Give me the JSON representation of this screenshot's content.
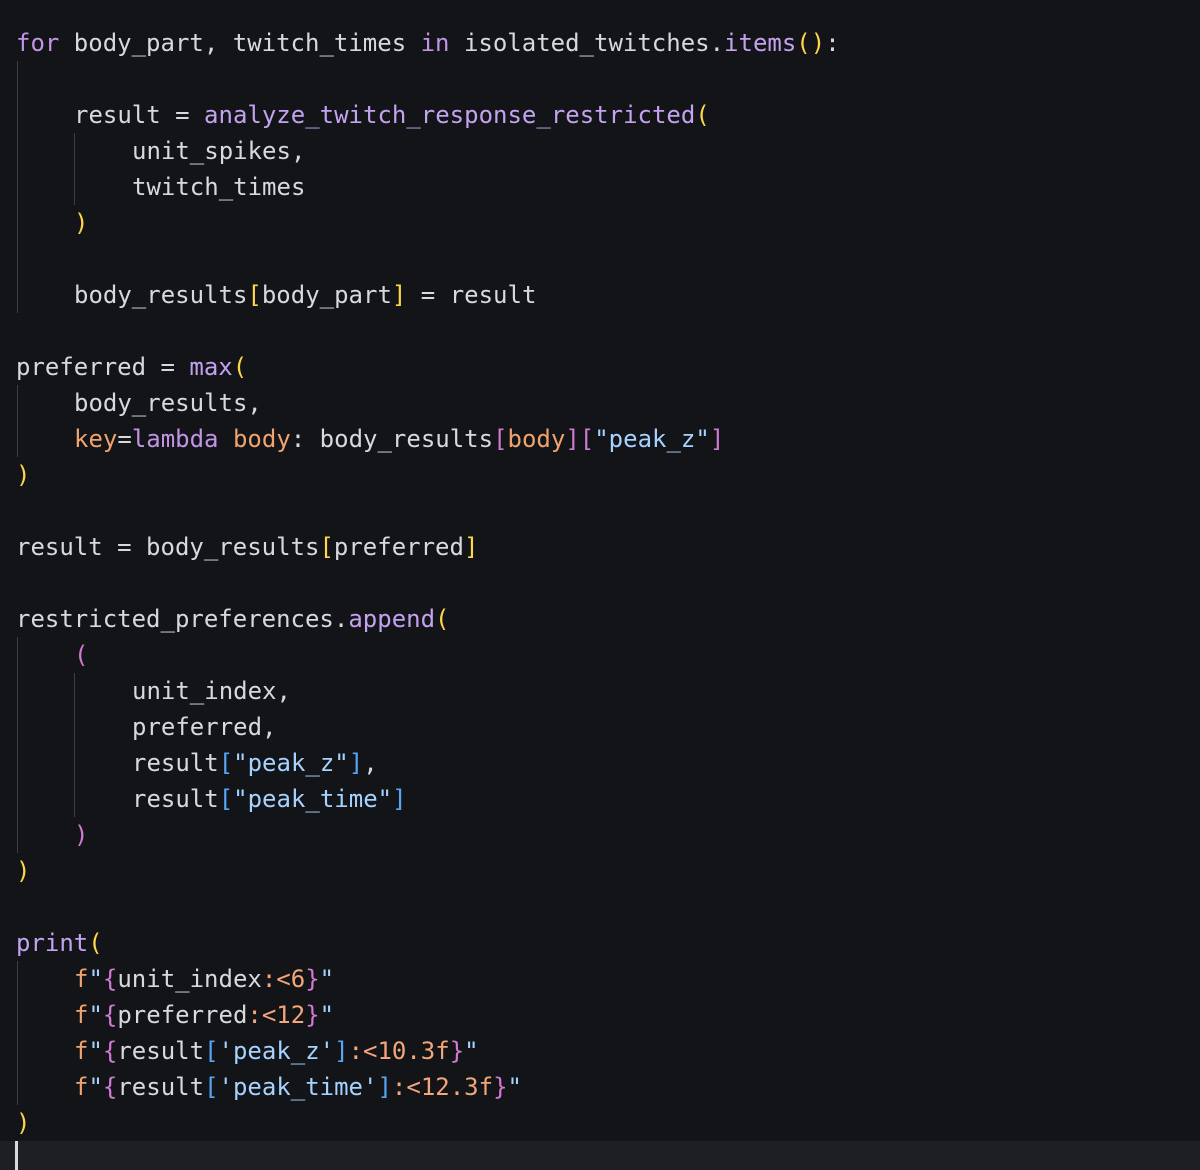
{
  "editor": {
    "language": "python",
    "code": {
      "l1": {
        "for": "for",
        "vars": " body_part, twitch_times ",
        "in": "in",
        "obj": " isolated_twitches.",
        "method": "items",
        "open": "(",
        "close": ")",
        "colon": ":"
      },
      "l3": {
        "lhs": "result = ",
        "call": "analyze_twitch_response_restricted",
        "open": "("
      },
      "l4": {
        "text": "unit_spikes,"
      },
      "l5": {
        "text": "twitch_times"
      },
      "l6": {
        "close": ")"
      },
      "l8": {
        "obj": "body_results",
        "open": "[",
        "key": "body_part",
        "close": "]",
        "rhs": " = result"
      },
      "l10": {
        "lhs": "preferred = ",
        "call": "max",
        "open": "("
      },
      "l11": {
        "text": "body_results,"
      },
      "l12": {
        "param": "key",
        "eq": "=",
        "lambda": "lambda",
        "arg": " body",
        "colon": ": ",
        "obj": "body_results",
        "b1o": "[",
        "b1k": "body",
        "b1c": "]",
        "b2o": "[",
        "b2k": "\"peak_z\"",
        "b2c": "]"
      },
      "l13": {
        "close": ")"
      },
      "l15": {
        "lhs": "result = body_results",
        "open": "[",
        "key": "preferred",
        "close": "]"
      },
      "l17": {
        "obj": "restricted_preferences.",
        "call": "append",
        "open": "("
      },
      "l18": {
        "open": "("
      },
      "l19": {
        "text": "unit_index,"
      },
      "l20": {
        "text": "preferred,"
      },
      "l21": {
        "obj": "result",
        "open": "[",
        "key": "\"peak_z\"",
        "close": "]",
        "comma": ","
      },
      "l22": {
        "obj": "result",
        "open": "[",
        "key": "\"peak_time\"",
        "close": "]"
      },
      "l23": {
        "close": ")"
      },
      "l24": {
        "close": ")"
      },
      "l26": {
        "call": "print",
        "open": "("
      },
      "l27": {
        "f": "f",
        "q1": "\"",
        "bo": "{",
        "expr": "unit_index",
        "spec": ":<6",
        "bc": "}",
        "q2": "\""
      },
      "l28": {
        "f": "f",
        "q1": "\"",
        "bo": "{",
        "expr": "preferred",
        "spec": ":<12",
        "bc": "}",
        "q2": "\""
      },
      "l29": {
        "f": "f",
        "q1": "\"",
        "bo": "{",
        "expr": "result",
        "so": "[",
        "key": "'peak_z'",
        "sc": "]",
        "spec": ":<10.3f",
        "bc": "}",
        "q2": "\""
      },
      "l30": {
        "f": "f",
        "q1": "\"",
        "bo": "{",
        "expr": "result",
        "so": "[",
        "key": "'peak_time'",
        "sc": "]",
        "spec": ":<12.3f",
        "bc": "}",
        "q2": "\""
      },
      "l31": {
        "close": ")"
      }
    },
    "colors": {
      "background": "#131417",
      "text": "#d6d9de",
      "keyword": "#c294e6",
      "function": "#c3a2ef",
      "string": "#a5d2ff",
      "format_spec": "#f3a67a",
      "parameter": "#f0a36e",
      "bracket_level_1": "#ffd54a",
      "bracket_level_2": "#d07ad6",
      "bracket_level_3": "#56a6f6",
      "indent_guide": "#3b3e44",
      "current_line": "#1d1f23"
    }
  }
}
